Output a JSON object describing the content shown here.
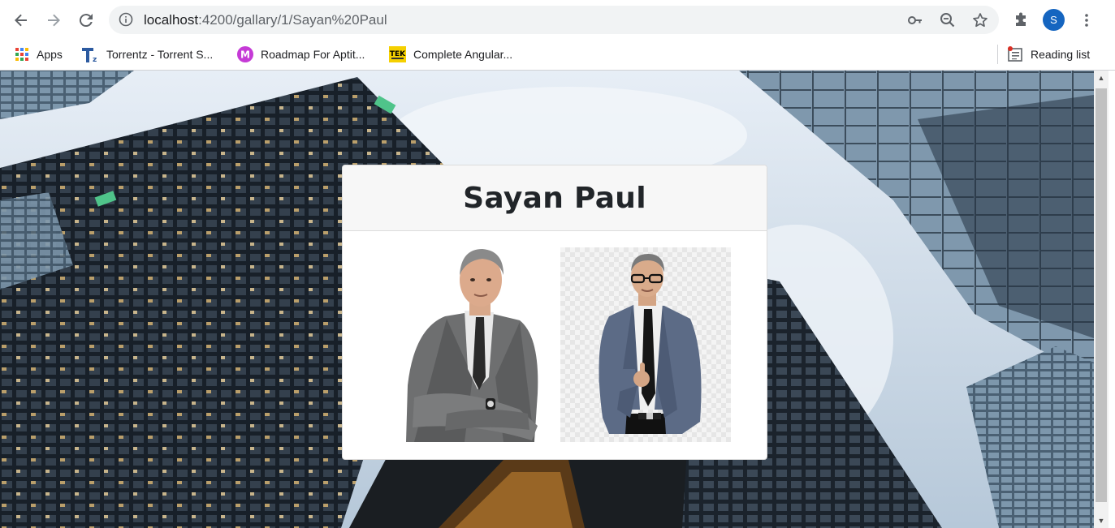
{
  "browser": {
    "url_host": "localhost",
    "url_path": ":4200/gallary/1/Sayan%20Paul",
    "profile_initial": "S",
    "bookmarks": [
      {
        "label": "Apps",
        "icon": "apps-grid-icon"
      },
      {
        "label": "Torrentz - Torrent S...",
        "icon": "torrentz-favicon"
      },
      {
        "label": "Roadmap For Aptit...",
        "icon": "roadmap-m-favicon"
      },
      {
        "label": "Complete Angular...",
        "icon": "tek-favicon"
      }
    ],
    "reading_list_label": "Reading list"
  },
  "page": {
    "card_title": "Sayan Paul",
    "photos": [
      {
        "alt": "man in grey suit with crossed arms",
        "background": "white"
      },
      {
        "alt": "man in blue suit with glasses giving thumbs up",
        "background": "checkerboard"
      }
    ]
  },
  "colors": {
    "avatar": "#1565c0",
    "card_header_bg": "#f7f7f7",
    "sky": "#dde7f0"
  }
}
